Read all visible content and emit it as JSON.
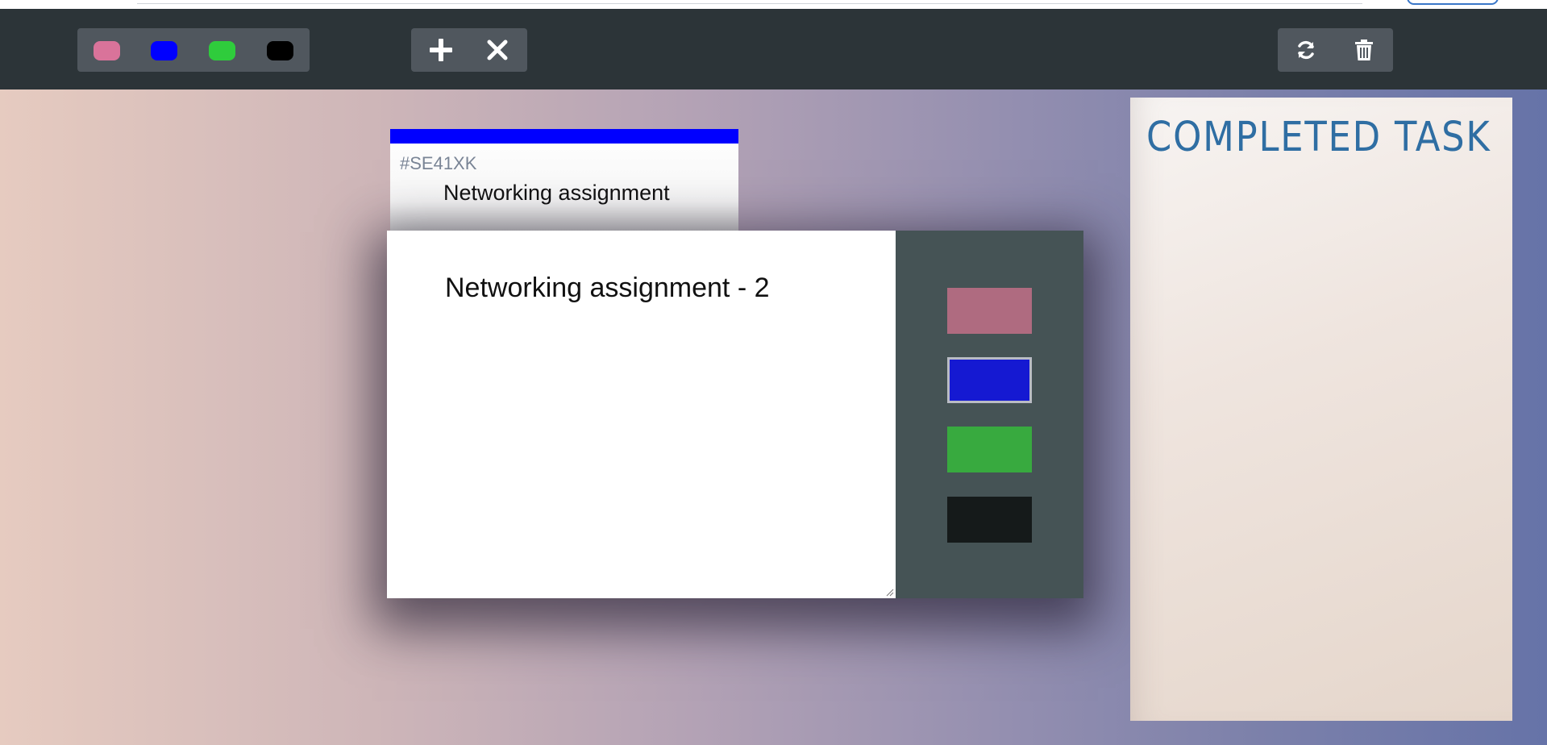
{
  "toolbar": {
    "color_swatches": [
      {
        "name": "pink",
        "color": "#d9739a"
      },
      {
        "name": "blue",
        "color": "#0000ff"
      },
      {
        "name": "green",
        "color": "#2fcc3c"
      },
      {
        "name": "black",
        "color": "#000000"
      }
    ],
    "add_icon": "plus-icon",
    "close_icon": "close-icon",
    "refresh_icon": "refresh-icon",
    "delete_icon": "trash-icon"
  },
  "task_card": {
    "id": "#SE41XK",
    "title": "Networking assignment",
    "accent_color": "#0000ff"
  },
  "editor_modal": {
    "content": "Networking assignment - 2",
    "color_options": [
      {
        "name": "pink",
        "color": "#af6b80",
        "selected": false
      },
      {
        "name": "blue",
        "color": "#1519d2",
        "selected": true
      },
      {
        "name": "green",
        "color": "#38aa3f",
        "selected": false
      },
      {
        "name": "black",
        "color": "#151a1a",
        "selected": false
      }
    ]
  },
  "completed_panel": {
    "title": "COMPLETED TASK"
  }
}
